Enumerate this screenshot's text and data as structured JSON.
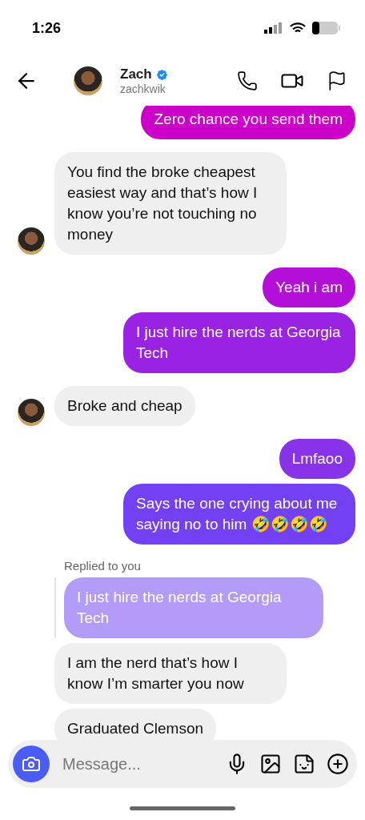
{
  "status_bar": {
    "time": "1:26"
  },
  "header": {
    "name": "Zach",
    "verified": true,
    "username": "zachkwik"
  },
  "messages": [
    {
      "kind": "sent",
      "text": "Zero chance you send them",
      "color": "#cc00c8"
    },
    {
      "kind": "received",
      "text": "You find the broke cheapest easiest way and that’s how I know you’re not touching no money",
      "avatar": true
    },
    {
      "kind": "sent",
      "text": "Yeah i am",
      "color": "#b40fd8"
    },
    {
      "kind": "sent",
      "text": "I just hire the nerds at Georgia Tech",
      "color": "#9a22e2"
    },
    {
      "kind": "received",
      "text": "Broke and cheap",
      "avatar": true
    },
    {
      "kind": "sent",
      "text": "Lmfaoo",
      "color": "#8832ea"
    },
    {
      "kind": "sent",
      "text": "Says the one crying about me saying no to him 🤣🤣🤣🤣",
      "color": "#7340f4"
    },
    {
      "kind": "reply",
      "label": "Replied to you",
      "text": "I just hire the nerds at Georgia Tech"
    },
    {
      "kind": "received",
      "text": "I am the nerd that’s how I know I’m smarter you now",
      "avatar": false
    },
    {
      "kind": "received",
      "text": "Graduated Clemson",
      "avatar": false
    }
  ],
  "composer": {
    "placeholder": "Message..."
  }
}
